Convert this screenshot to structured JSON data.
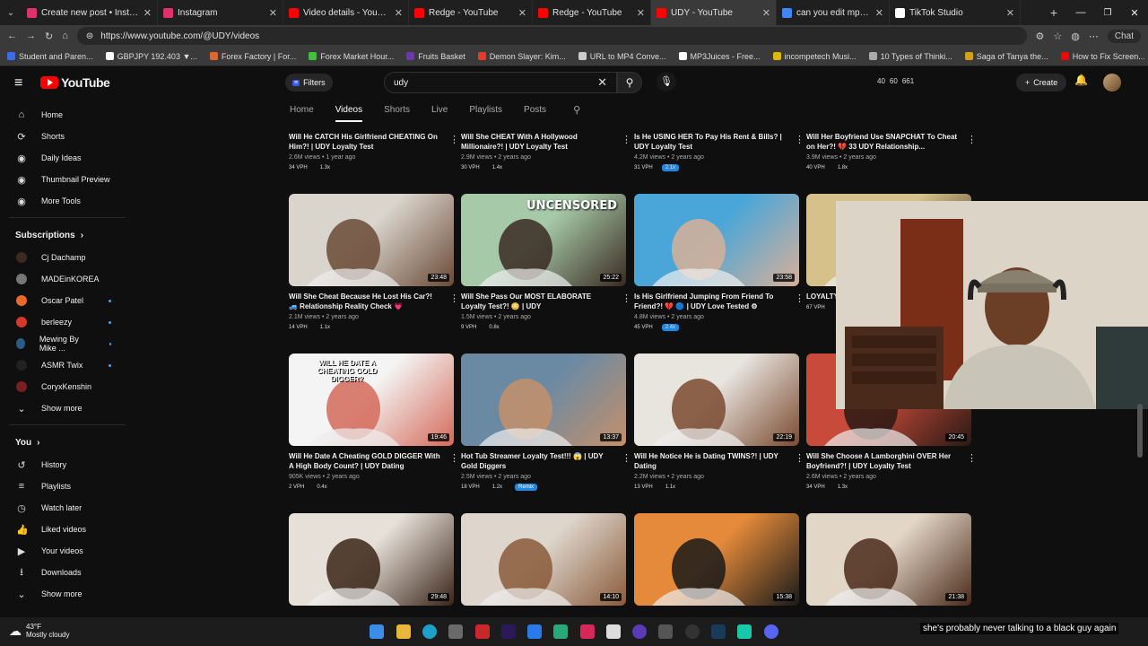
{
  "browser": {
    "tabs": [
      {
        "title": "Create new post • Instagram",
        "color": "#e1306c"
      },
      {
        "title": "Instagram",
        "color": "#e1306c"
      },
      {
        "title": "Video details - YouTube Stu",
        "color": "#ff0000"
      },
      {
        "title": "Redge - YouTube",
        "color": "#ff0000"
      },
      {
        "title": "Redge - YouTube",
        "color": "#ff0000"
      },
      {
        "title": "UDY - YouTube",
        "color": "#ff0000"
      },
      {
        "title": "can you edit mpg files on ca",
        "color": "#4285f4"
      },
      {
        "title": "TikTok Studio",
        "color": "#ffffff"
      }
    ],
    "url": "https://www.youtube.com/@UDY/videos",
    "chat_label": "Chat",
    "bookmarks": [
      {
        "label": "Student and Paren...",
        "color": "#3a6ee8"
      },
      {
        "label": "GBPJPY 192.403 ▼...",
        "color": "#ffffff"
      },
      {
        "label": "Forex Factory | For...",
        "color": "#e0672b"
      },
      {
        "label": "Forex Market Hour...",
        "color": "#41c13b"
      },
      {
        "label": "Fruits Basket",
        "color": "#6b3aa8"
      },
      {
        "label": "Demon Slayer: Kim...",
        "color": "#e33b2e"
      },
      {
        "label": "URL to MP4 Conve...",
        "color": "#cccccc"
      },
      {
        "label": "MP3Juices - Free...",
        "color": "#ffffff"
      },
      {
        "label": "incompetech Musi...",
        "color": "#e0b800"
      },
      {
        "label": "10 Types of Thinki...",
        "color": "#aaaaaa"
      },
      {
        "label": "Saga of Tanya the...",
        "color": "#d4a017"
      },
      {
        "label": "How to Fix Screen...",
        "color": "#ff0000"
      }
    ]
  },
  "yt": {
    "logo_text": "YouTube",
    "filters_label": "Filters",
    "search_value": "udy",
    "stats": [
      "40",
      "60",
      "661"
    ],
    "create_label": "Create",
    "channel_tabs": [
      "Home",
      "Videos",
      "Shorts",
      "Live",
      "Playlists",
      "Posts"
    ],
    "active_tab": "Videos"
  },
  "sidebar": {
    "main": [
      {
        "label": "Home",
        "icon": "⌂"
      },
      {
        "label": "Shorts",
        "icon": "⟳"
      },
      {
        "label": "Daily Ideas",
        "icon": "◉"
      },
      {
        "label": "Thumbnail Preview",
        "icon": "◉"
      },
      {
        "label": "More Tools",
        "icon": "◉"
      }
    ],
    "subs_heading": "Subscriptions",
    "subs": [
      {
        "label": "Cj Dachamp",
        "color": "#3b2a20",
        "dot": false
      },
      {
        "label": "MADEinKOREA",
        "color": "#777777",
        "dot": false
      },
      {
        "label": "Oscar Patel",
        "color": "#e86a2a",
        "dot": true
      },
      {
        "label": "berleezy",
        "color": "#d8382a",
        "dot": true
      },
      {
        "label": "Mewing By Mike ...",
        "color": "#2a5b8a",
        "dot": true
      },
      {
        "label": "ASMR Twix",
        "color": "#222222",
        "dot": true
      },
      {
        "label": "CoryxKenshin",
        "color": "#7a1f1f",
        "dot": false
      }
    ],
    "show_more": "Show more",
    "you_heading": "You",
    "you_items": [
      {
        "label": "History",
        "icon": "↺"
      },
      {
        "label": "Playlists",
        "icon": "≡"
      },
      {
        "label": "Watch later",
        "icon": "◷"
      },
      {
        "label": "Liked videos",
        "icon": "👍"
      },
      {
        "label": "Your videos",
        "icon": "▶"
      },
      {
        "label": "Downloads",
        "icon": "⭳"
      }
    ],
    "show_more_2": "Show more"
  },
  "videos": [
    {
      "title": "Will He CATCH His Girlfriend CHEATING On Him?! | UDY Loyalty Test",
      "views": "2.6M views",
      "age": "1 year ago",
      "vph": "34 VPH",
      "mult": "1.3x",
      "badge": false
    },
    {
      "title": "Will She CHEAT With A Hollywood Millionaire?! | UDY Loyalty Test",
      "views": "2.9M views",
      "age": "2 years ago",
      "vph": "30 VPH",
      "mult": "1.4x",
      "badge": false
    },
    {
      "title": "Is He USING HER To Pay His Rent & Bills? | UDY Loyalty Test",
      "views": "4.2M views",
      "age": "2 years ago",
      "vph": "31 VPH",
      "mult": "2.1x",
      "badge": true
    },
    {
      "title": "Will Her Boyfriend Use SNAPCHAT To Cheat on Her?! 💔 33 UDY Relationship...",
      "views": "3.9M views",
      "age": "2 years ago",
      "vph": "40 VPH",
      "mult": "1.8x",
      "badge": false
    },
    {
      "title": "Will She Cheat Because He Lost His Car?! 🚙 Relationship Reality Check 💗",
      "views": "2.1M views",
      "age": "2 years ago",
      "vph": "14 VPH",
      "mult": "1.1x",
      "badge": false,
      "dur": "23:48",
      "c1": "#d9d4cc",
      "c2": "#6a4a36"
    },
    {
      "title": "Will She Pass Our MOST ELABORATE Loyalty Test?! 😳 | UDY",
      "views": "1.5M views",
      "age": "2 years ago",
      "vph": "9 VPH",
      "mult": "0.8x",
      "badge": false,
      "dur": "25:22",
      "c1": "#a6c9a8",
      "c2": "#3a2a22",
      "overlay": "UNCENSORED"
    },
    {
      "title": "Is His Girlfriend Jumping From Friend To Friend?! 💔 🔵 | UDY Love Tested ⚙",
      "views": "4.8M views",
      "age": "2 years ago",
      "vph": "45 VPH",
      "mult": "2.4x",
      "badge": true,
      "dur": "23:58",
      "c1": "#4aa6d8",
      "c2": "#d8b098"
    },
    {
      "title": "LOYALTY TEST...Expected...",
      "views": "",
      "age": "",
      "vph": "67 VPH",
      "mult": "",
      "badge": false,
      "dur": "",
      "c1": "#d6c18a",
      "c2": "#3a2a22"
    },
    {
      "title": "Will He Date A Cheating GOLD DIGGER With A High Body Count? | UDY Dating",
      "views": "905K views",
      "age": "2 years ago",
      "vph": "2 VPH",
      "mult": "0.4x",
      "badge": false,
      "dur": "19:46",
      "c1": "#f4f4f4",
      "c2": "#d46a5a",
      "overlay": "WILL HE DATE A CHEATING GOLD DIGGER?"
    },
    {
      "title": "Hot Tub Streamer Loyalty Test!!! 😱 | UDY Gold Diggers",
      "views": "2.5M views",
      "age": "2 years ago",
      "vph": "18 VPH",
      "mult": "1.2x",
      "badge": false,
      "remix": "Remix",
      "dur": "13:37",
      "c1": "#6a8aa4",
      "c2": "#c48f6a"
    },
    {
      "title": "Will He Notice He is Dating TWINS?! | UDY Dating",
      "views": "2.2M views",
      "age": "2 years ago",
      "vph": "13 VPH",
      "mult": "1.1x",
      "badge": false,
      "dur": "22:19",
      "c1": "#e8e4de",
      "c2": "#7a4a30"
    },
    {
      "title": "Will She Choose A Lamborghini OVER Her Boyfriend?! | UDY Loyalty Test",
      "views": "2.6M views",
      "age": "2 years ago",
      "vph": "34 VPH",
      "mult": "1.3x",
      "badge": false,
      "dur": "20:45",
      "c1": "#c84a3a",
      "c2": "#2a1a14"
    },
    {
      "title": "",
      "dur": "29:48",
      "c1": "#e6e0d8",
      "c2": "#3a2418"
    },
    {
      "title": "",
      "dur": "14:10",
      "c1": "#ded6cc",
      "c2": "#8a5a3a"
    },
    {
      "title": "",
      "dur": "15:38",
      "c1": "#e48a3a",
      "c2": "#1a1a1a"
    },
    {
      "title": "",
      "dur": "21:38",
      "c1": "#e2d6c6",
      "c2": "#4a2a1a"
    }
  ],
  "caption": "she's probably never talking to a black guy again",
  "weather": {
    "temp": "43°F",
    "desc": "Mostly cloudy"
  }
}
